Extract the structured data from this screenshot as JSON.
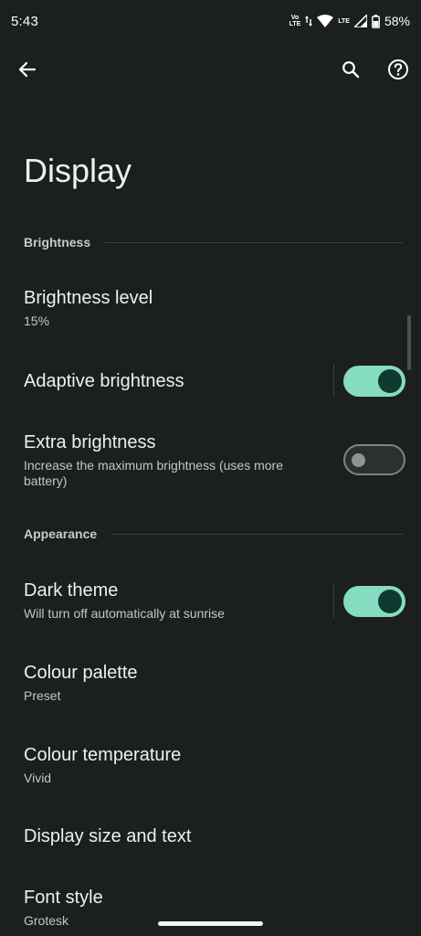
{
  "status_bar": {
    "time": "5:43",
    "volte_top": "Vo",
    "volte_bottom": "LTE",
    "lte_label": "LTE",
    "battery": "58%"
  },
  "app_bar": {
    "back_icon": "arrow-back-icon",
    "search_icon": "search-icon",
    "help_icon": "help-icon"
  },
  "page": {
    "title": "Display"
  },
  "sections": {
    "brightness": {
      "header": "Brightness",
      "brightness_level": {
        "title": "Brightness level",
        "value": "15%"
      },
      "adaptive_brightness": {
        "title": "Adaptive brightness",
        "enabled": true
      },
      "extra_brightness": {
        "title": "Extra brightness",
        "subtitle": "Increase the maximum brightness (uses more battery)",
        "enabled": false
      }
    },
    "appearance": {
      "header": "Appearance",
      "dark_theme": {
        "title": "Dark theme",
        "subtitle": "Will turn off automatically at sunrise",
        "enabled": true
      },
      "colour_palette": {
        "title": "Colour palette",
        "value": "Preset"
      },
      "colour_temperature": {
        "title": "Colour temperature",
        "value": "Vivid"
      },
      "display_size": {
        "title": "Display size and text"
      },
      "font_style": {
        "title": "Font style",
        "value": "Grotesk"
      }
    }
  },
  "colors": {
    "background": "#1b1f1e",
    "switch_on_track": "#86dcc0",
    "switch_on_thumb": "#0f3a30",
    "switch_off_border": "#7d8582"
  }
}
